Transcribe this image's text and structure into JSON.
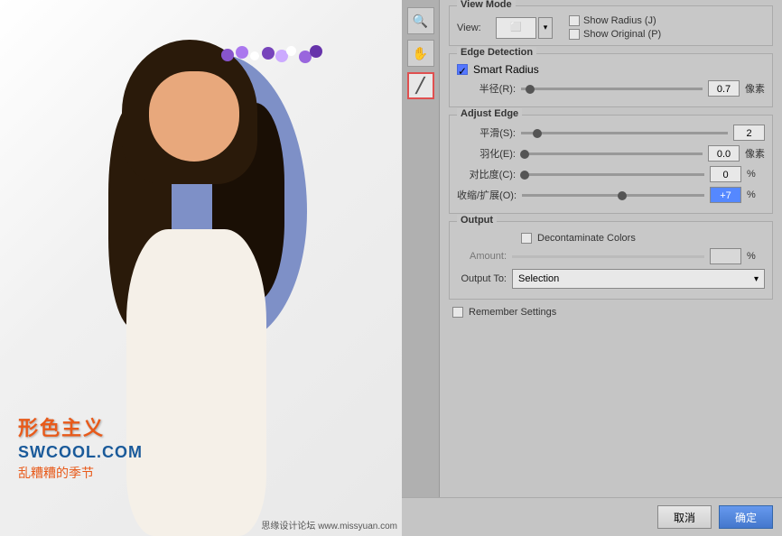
{
  "photo": {
    "watermark_title": "形色主义",
    "watermark_url": "SWCOOL.COM",
    "watermark_subtitle": "乱糟糟的季节",
    "watermark_site": "思缘设计论坛 www.missyuan.com"
  },
  "toolbar": {
    "tools": [
      {
        "id": "magnifier",
        "icon": "🔍",
        "selected": false
      },
      {
        "id": "hand",
        "icon": "✋",
        "selected": false
      },
      {
        "id": "brush",
        "icon": "╱",
        "selected": true
      }
    ]
  },
  "view_mode": {
    "section_label": "View Mode",
    "view_label": "View:",
    "show_radius_label": "Show Radius (J)",
    "show_original_label": "Show Original (P)"
  },
  "edge_detection": {
    "section_label": "Edge Detection",
    "smart_radius_label": "Smart Radius",
    "smart_radius_checked": true,
    "radius_label": "半径(R):",
    "radius_value": "0.7",
    "radius_unit": "像素"
  },
  "adjust_edge": {
    "section_label": "Adjust Edge",
    "smooth_label": "平滑(S):",
    "smooth_value": "2",
    "feather_label": "羽化(E):",
    "feather_value": "0.0",
    "feather_unit": "像素",
    "contrast_label": "对比度(C):",
    "contrast_value": "0",
    "contrast_unit": "%",
    "shift_label": "收缩/扩展(O):",
    "shift_value": "+7",
    "shift_unit": "%"
  },
  "output": {
    "section_label": "Output",
    "decontaminate_label": "Decontaminate Colors",
    "decontaminate_checked": false,
    "amount_label": "Amount:",
    "output_to_label": "Output To:",
    "output_to_value": "Selection"
  },
  "remember": {
    "label": "Remember Settings",
    "checked": false
  },
  "buttons": {
    "cancel": "取消",
    "ok": "确定"
  }
}
